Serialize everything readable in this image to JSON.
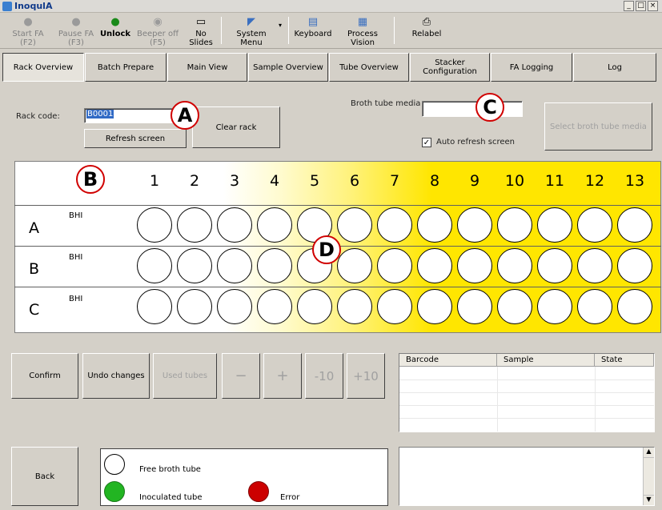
{
  "window": {
    "title": "InoqulA",
    "controls": [
      "_",
      "□",
      "×"
    ]
  },
  "toolbar": {
    "items": [
      {
        "label": "Start FA (F2)",
        "icon": "start-icon",
        "glyph": "●",
        "enabled": false
      },
      {
        "label": "Pause FA (F3)",
        "icon": "pause-icon",
        "glyph": "●",
        "enabled": false
      },
      {
        "label": "Unlock",
        "icon": "unlock-icon",
        "glyph": "🔒",
        "enabled": true
      },
      {
        "label": "Beeper off (F5)",
        "icon": "beeper-icon",
        "glyph": "◉",
        "enabled": false
      },
      {
        "label": "No Slides",
        "icon": "slides-icon",
        "glyph": "▭",
        "enabled": true
      },
      {
        "label": "System Menu",
        "icon": "system-menu-icon",
        "glyph": "◤",
        "enabled": true
      },
      {
        "label": "Keyboard",
        "icon": "keyboard-icon",
        "glyph": "▤",
        "enabled": true
      },
      {
        "label": "Process Vision",
        "icon": "process-vision-icon",
        "glyph": "▦",
        "enabled": true
      },
      {
        "label": "Relabel",
        "icon": "printer-icon",
        "glyph": "⎙",
        "enabled": true
      }
    ]
  },
  "nav": {
    "tabs": [
      {
        "label": "Rack Overview",
        "active": true
      },
      {
        "label": "Batch Prepare"
      },
      {
        "label": "Main View"
      },
      {
        "label": "Sample Overview"
      },
      {
        "label": "Tube Overview"
      },
      {
        "label": "Stacker Configuration"
      },
      {
        "label": "FA Logging"
      },
      {
        "label": "Log"
      }
    ]
  },
  "rackpanel": {
    "rack_code_label": "Rack code:",
    "rack_code_value": "B0001",
    "refresh_label": "Refresh screen",
    "clear_label": "Clear rack",
    "broth_label": "Broth tube media",
    "broth_value": "",
    "select_media_label": "Select broth tube media",
    "auto_refresh_label": "Auto refresh screen",
    "auto_refresh_checked": true
  },
  "callouts": {
    "a": "A",
    "b": "B",
    "c": "C",
    "d": "D"
  },
  "rack": {
    "columns": [
      "1",
      "2",
      "3",
      "4",
      "5",
      "6",
      "7",
      "8",
      "9",
      "10",
      "11",
      "12",
      "13"
    ],
    "rows": [
      {
        "label": "A",
        "media": "BHI"
      },
      {
        "label": "B",
        "media": "BHI"
      },
      {
        "label": "C",
        "media": "BHI"
      }
    ]
  },
  "actions": {
    "confirm": "Confirm",
    "undo": "Undo changes",
    "used_tubes": "Used tubes",
    "minus": "−",
    "plus": "+",
    "minus10": "-10",
    "plus10": "+10",
    "back": "Back"
  },
  "table": {
    "headers": [
      "Barcode",
      "Sample",
      "State"
    ]
  },
  "legend": {
    "free": "Free broth tube",
    "inoculated": "Inoculated tube",
    "error": "Error",
    "colors": {
      "free": "#ffffff",
      "inoculated": "#22b522",
      "error": "#cc0000"
    }
  }
}
